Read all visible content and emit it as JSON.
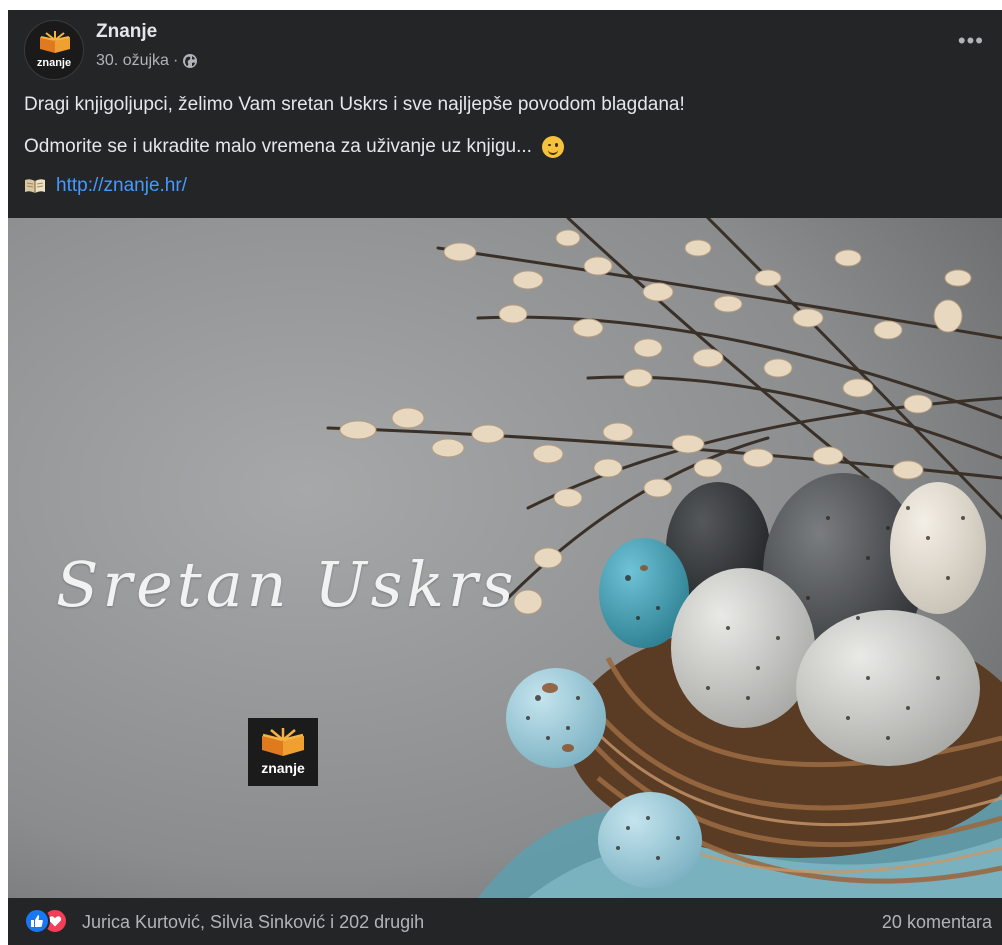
{
  "post": {
    "page_name": "Znanje",
    "date": "30. ožujka",
    "meta_separator": "·",
    "avatar_word": "znanje",
    "more_label": "•••",
    "text_line1": "Dragi knjigoljupci, želimo Vam sretan Uskrs i sve najljepše povodom blagdana!",
    "text_line2": "Odmorite se i ukradite malo vremena za uživanje uz knjigu...",
    "link": "http://znanje.hr/",
    "icons": {
      "privacy": "globe-icon",
      "emoji": "winking-face-emoji",
      "link_prefix": "open-book-icon",
      "reactions": [
        "like-reaction-icon",
        "love-reaction-icon"
      ]
    }
  },
  "image": {
    "greeting_text": "Sretan Uskrs",
    "logo_word": "znanje"
  },
  "footer": {
    "reactors": "Jurica Kurtović, Silvia Sinković i 202 drugih",
    "comments": "20 komentara"
  },
  "colors": {
    "background": "#242526",
    "text": "#e4e6eb",
    "secondary_text": "#b0b3b8",
    "link": "#4599ff",
    "like": "#1877f2",
    "love": "#f33e58"
  }
}
